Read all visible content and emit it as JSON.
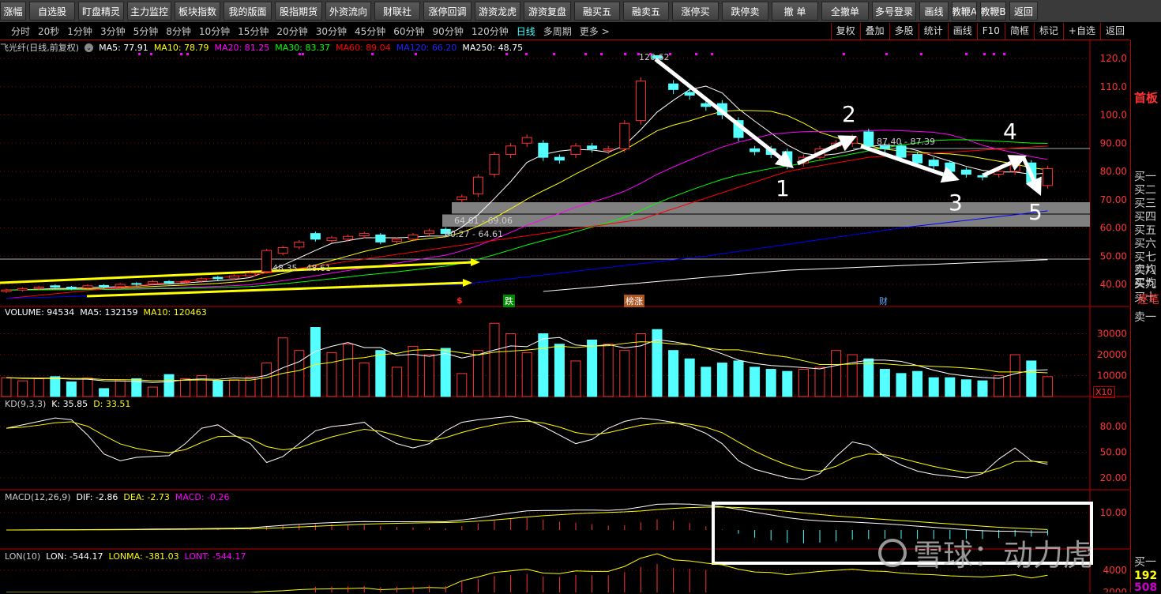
{
  "toolbar": [
    "涨幅",
    "自选股",
    "盯盘精灵",
    "主力监控",
    "板块指数",
    "我的版面",
    "股指期货",
    "外资流向",
    "财联社",
    "涨停回调",
    "游资龙虎",
    "游资复盘",
    "融买五",
    "融卖五",
    "涨停买",
    "跌停卖",
    "撤 单",
    "全撤单",
    "多号登录",
    "画线",
    "教鞭A",
    "教鞭B",
    "返回"
  ],
  "periods": [
    "分时",
    "20秒",
    "1分钟",
    "3分钟",
    "5分钟",
    "8分钟",
    "10分钟",
    "15分钟",
    "20分钟",
    "30分钟",
    "45分钟",
    "60分钟",
    "90分钟",
    "120分钟",
    "日线",
    "多周期",
    "更多 >"
  ],
  "active_period": "日线",
  "right_tools": [
    "复权",
    "叠加",
    "多股",
    "统计",
    "画线",
    "F10",
    "简框",
    "标记",
    "+自选",
    "返回"
  ],
  "main_legend": {
    "title": "飞光纤(日线,前复权)",
    "ma5": "MA5: 77.91",
    "ma10": "MA10: 78.79",
    "ma20": "MA20: 81.25",
    "ma30": "MA30: 83.37",
    "ma60": "MA60: 89.04",
    "ma120": "MA120: 66.20",
    "ma250": "MA250: 48.75"
  },
  "volume_legend": {
    "title": "VOLUME: 94534",
    "ma5": "MA5: 132159",
    "ma10": "MA10: 120463"
  },
  "kd_legend": {
    "title": "KD(9,3,3)",
    "k": "K: 35.85",
    "d": "D: 33.51"
  },
  "macd_legend": {
    "title": "MACD(12,26,9)",
    "dif": "DIF: -2.86",
    "dea": "DEA: -2.73",
    "macd": "MACD: -0.26"
  },
  "lon_legend": {
    "title": "LON(10)",
    "lon": "LON: -544.17",
    "lonma": "LONMA: -381.03",
    "lont": "LONT: -544.17"
  },
  "annotations": {
    "high": "120.62",
    "zone1": "64.61 - 69.06",
    "zone2": "60.27 - 64.61",
    "line1": "87.40 - 87.39",
    "line2": "48.35 - 48.61",
    "wave": [
      "1",
      "2",
      "3",
      "4",
      "5"
    ],
    "markers": {
      "dollar": "$",
      "drop": "跌",
      "rank": "榜涨",
      "fin": "财"
    }
  },
  "axes": {
    "price": [
      "120.0",
      "110.0",
      "100.0",
      "90.00",
      "80.00",
      "70.00",
      "60.00",
      "50.00",
      "40.00"
    ],
    "volume": [
      "30000",
      "20000",
      "10000"
    ],
    "vol_unit": "X10",
    "kd": [
      "80.00",
      "50.00",
      "20.00"
    ],
    "macd": [
      "10.00"
    ],
    "lon": [
      "4000",
      "2000"
    ]
  },
  "right_panel": {
    "tag": "首板",
    "bids": [
      "买一",
      "买二",
      "买三",
      "买四",
      "买五",
      "买六",
      "买七",
      "买八",
      "买九",
      "买十"
    ],
    "avg": [
      "卖均",
      "买均"
    ],
    "tick": "逐笔",
    "ask1": "卖一",
    "bid1": "买一",
    "n1": "192",
    "n2": "508"
  },
  "watermark": "雪球：动力虎",
  "colors": {
    "up": "#ff3333",
    "down": "#54ffff",
    "ma5": "#ffffff",
    "ma10": "#ffff00",
    "ma20": "#ff00ff",
    "ma30": "#00ff00",
    "ma60": "#ff0000",
    "ma120": "#0000ff",
    "ma250": "#ffffff"
  },
  "chart_data": {
    "type": "candlestick",
    "ylim": [
      35,
      123
    ],
    "open": [
      37.5,
      38,
      38.5,
      39.5,
      39,
      38.8,
      39.6,
      39.2,
      40.3,
      40.2,
      41,
      40.8,
      41.2,
      42.5,
      42.2,
      43,
      44.5,
      51,
      53.2,
      58,
      55.5,
      56,
      57.2,
      57.5,
      55.2,
      56,
      58,
      59.5,
      70,
      72,
      79,
      86,
      90,
      90,
      85,
      86,
      89,
      87.5,
      88,
      98,
      121,
      111,
      108,
      104,
      104,
      98,
      88,
      88,
      87,
      83,
      85,
      89,
      90,
      94,
      89,
      89,
      86,
      84,
      83,
      80.5,
      78.5,
      79,
      80,
      83,
      75
    ],
    "close": [
      38,
      38.5,
      39,
      39,
      38.5,
      39.5,
      39,
      40,
      40,
      41,
      40.5,
      41,
      42,
      42,
      43,
      44,
      52,
      53,
      55,
      56,
      56.5,
      57,
      58,
      55,
      56,
      57.5,
      59,
      58,
      71,
      78,
      86,
      89,
      92,
      85,
      84,
      89,
      88,
      88,
      97,
      112,
      120,
      109,
      107,
      103,
      100,
      92,
      87,
      86,
      82,
      85,
      88,
      90,
      92,
      89,
      88,
      85,
      83,
      82,
      80,
      79,
      78,
      80,
      82,
      76,
      81
    ],
    "volume": [
      9000,
      7500,
      8500,
      9500,
      7000,
      8800,
      3800,
      8000,
      8500,
      4500,
      10500,
      8500,
      10000,
      7500,
      8000,
      9200,
      16000,
      28000,
      22000,
      33000,
      21000,
      25000,
      16000,
      22000,
      14000,
      24000,
      20000,
      23000,
      11000,
      22000,
      35000,
      30000,
      21000,
      30000,
      25000,
      17000,
      27000,
      25000,
      22000,
      30000,
      32000,
      22000,
      18000,
      14000,
      16000,
      17000,
      14000,
      13000,
      12000,
      13000,
      14000,
      22000,
      20000,
      18000,
      13000,
      11000,
      12000,
      9000,
      9000,
      8000,
      7500,
      10000,
      20000,
      17000,
      9500
    ],
    "k": [
      78,
      82,
      86,
      90,
      88,
      70,
      48,
      40,
      44,
      45,
      46,
      60,
      78,
      82,
      70,
      60,
      38,
      45,
      60,
      75,
      80,
      82,
      85,
      70,
      60,
      55,
      60,
      75,
      85,
      88,
      90,
      92,
      88,
      80,
      70,
      60,
      65,
      78,
      86,
      90,
      88,
      85,
      80,
      72,
      60,
      40,
      30,
      25,
      20,
      18,
      25,
      45,
      62,
      58,
      45,
      35,
      28,
      24,
      22,
      20,
      25,
      42,
      55,
      40,
      36
    ],
    "ma60": [
      [
        0,
        35
      ],
      [
        16,
        44
      ],
      [
        39,
        63
      ],
      [
        48,
        80
      ],
      [
        53,
        85
      ],
      [
        64,
        89
      ]
    ],
    "ma120": [
      [
        0,
        35
      ],
      [
        28,
        40
      ],
      [
        43,
        50
      ],
      [
        55,
        60
      ],
      [
        64,
        66
      ]
    ],
    "ma250": [
      [
        33,
        37.5
      ],
      [
        48,
        45
      ],
      [
        64,
        48.75
      ]
    ]
  }
}
